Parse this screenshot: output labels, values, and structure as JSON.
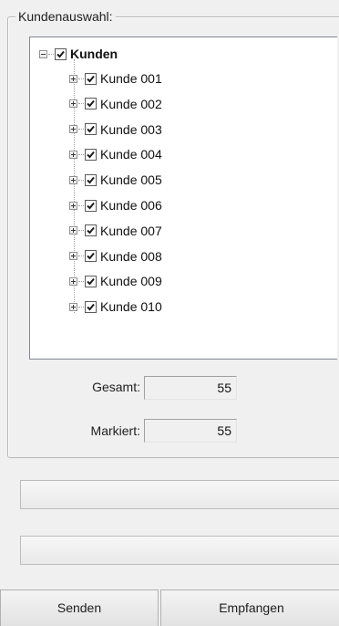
{
  "group": {
    "legend": "Kundenauswahl:"
  },
  "tree": {
    "root": {
      "label": "Kunden",
      "checked": true,
      "expanded": true
    },
    "items": [
      {
        "label": "Kunde 001",
        "checked": true
      },
      {
        "label": "Kunde 002",
        "checked": true
      },
      {
        "label": "Kunde 003",
        "checked": true
      },
      {
        "label": "Kunde 004",
        "checked": true
      },
      {
        "label": "Kunde 005",
        "checked": true
      },
      {
        "label": "Kunde 006",
        "checked": true
      },
      {
        "label": "Kunde 007",
        "checked": true
      },
      {
        "label": "Kunde 008",
        "checked": true
      },
      {
        "label": "Kunde 009",
        "checked": true
      },
      {
        "label": "Kunde 010",
        "checked": true
      }
    ]
  },
  "counters": {
    "total_label": "Gesamt:",
    "total_value": "55",
    "marked_label": "Markiert:",
    "marked_value": "55"
  },
  "status": {
    "line1": "",
    "line2": ""
  },
  "buttons": {
    "send_label": "Senden",
    "receive_label": "Empfangen"
  }
}
